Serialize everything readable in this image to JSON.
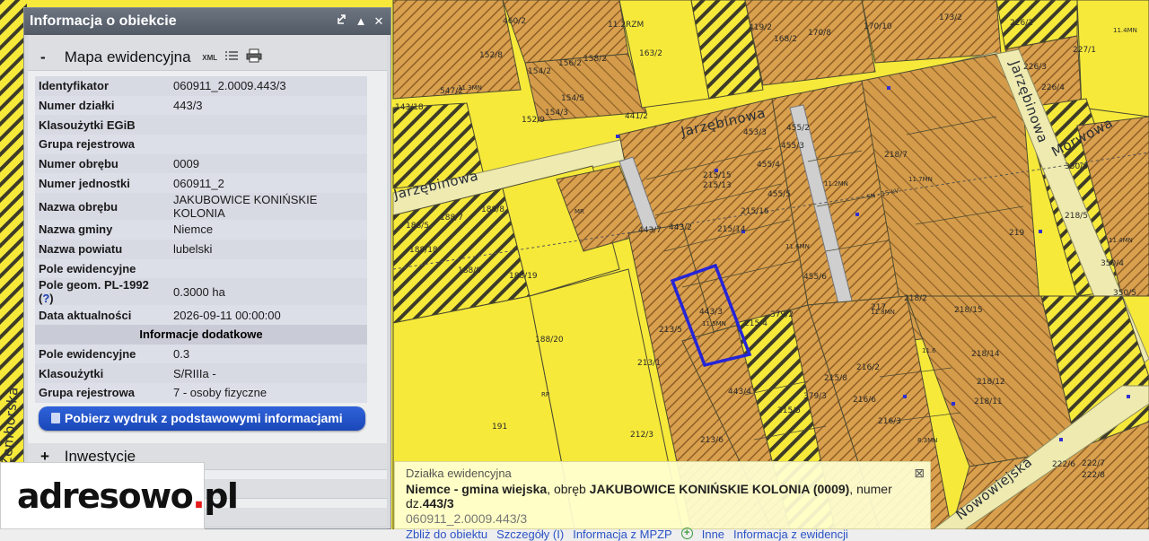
{
  "panel": {
    "title": "Informacja o obiekcie",
    "icons": [
      "link-icon",
      "collapse-up-icon",
      "close-icon"
    ],
    "section_mapa": {
      "sign": "-",
      "label": "Mapa ewidencyjna",
      "xml_label": "XML"
    },
    "attributes": [
      {
        "key": "Identyfikator",
        "value": "060911_2.0009.443/3"
      },
      {
        "key": "Numer działki",
        "value": "443/3"
      },
      {
        "key": "Klasoużytki EGiB",
        "value": ""
      },
      {
        "key": "Grupa rejestrowa",
        "value": ""
      },
      {
        "key": "Numer obrębu",
        "value": "0009"
      },
      {
        "key": "Numer jednostki",
        "value": "060911_2"
      },
      {
        "key": "Nazwa obrębu",
        "value": "JAKUBOWICE KONIŃSKIE KOLONIA"
      },
      {
        "key": "Nazwa gminy",
        "value": "Niemce"
      },
      {
        "key": "Nazwa powiatu",
        "value": "lubelski"
      },
      {
        "key": "Pole ewidencyjne",
        "value": ""
      },
      {
        "key": "Pole geom. PL-1992",
        "help": "?",
        "value": "0.3000 ha"
      },
      {
        "key": "Data aktualności",
        "value": "2026-09-11 00:00:00"
      }
    ],
    "subheader": "Informacje dodatkowe",
    "extra_attributes": [
      {
        "key": "Pole ewidencyjne",
        "value": "0.3"
      },
      {
        "key": "Klasoużytki",
        "value": "S/RIIIa -"
      },
      {
        "key": "Grupa rejestrowa",
        "value": "7 - osoby fizyczne"
      }
    ],
    "download_button": "Pobierz wydruk z podstawowymi informacjami",
    "section_inwestycje": {
      "sign": "+",
      "label": "Inwestycje"
    }
  },
  "logo": {
    "text_a": "adresowo",
    "dot": ".",
    "text_b": "pl"
  },
  "popup": {
    "title": "Działka ewidencyjna",
    "gmina": "Niemce - gmina wiejska",
    "sep1": ", obręb ",
    "obreb": "JAKUBOWICE KONIŃSKIE KOLONIA (0009)",
    "sep2": ", numer dz.",
    "numer": "443/3",
    "identifier": "060911_2.0009.443/3",
    "links": [
      "Zbliż do obiektu",
      "Szczegóły (I)",
      "Informacja z MPZP",
      "Inne",
      "Informacja z ewidencji"
    ]
  },
  "map": {
    "roads": [
      "Jarzębinowa",
      "Jarzębinowa",
      "Morwowa",
      "Jarzębinowa",
      "Nowowiejska",
      "Zemborska"
    ],
    "parcel_labels": [
      "460/2",
      "11.2RZM",
      "163/2",
      "419/2",
      "168/2",
      "170/8",
      "170/10",
      "173/2",
      "226/2",
      "227/1",
      "152/8",
      "154/2",
      "156/2",
      "158/2",
      "547/2",
      "154/3",
      "154/5",
      "152/9",
      "143/18",
      "441/2",
      "453/3",
      "455/3",
      "455/2",
      "218/7",
      "455/4",
      "188/5",
      "188/7",
      "188/8",
      "188/18",
      "188/9",
      "188/19",
      "188/20",
      "443/7",
      "443/2",
      "215/15",
      "215/16",
      "215/14",
      "215/13",
      "455/5",
      "455/6",
      "217",
      "219",
      "350/4",
      "350/5",
      "218/5",
      "218/2",
      "218/15",
      "218/14",
      "218/12",
      "443/3",
      "213/5",
      "215/4",
      "379/2",
      "213/1",
      "443/4",
      "215/8",
      "216/2",
      "216/6",
      "215/5",
      "379/3",
      "212/3",
      "213/6",
      "191",
      "218/11",
      "216/3",
      "222/6",
      "222/7",
      "222/8",
      "226/3",
      "226/4",
      "350/8",
      "11.4MN",
      "11.3MN",
      "11.5MN",
      "11.6MN",
      "11.8MN",
      "11.7MN",
      "11.2MN",
      "11.4MN",
      "8.3MN",
      "11.6",
      "RP",
      "MR",
      "SN - 15 kV"
    ]
  },
  "colors": {
    "zone_yellow": "#f6e93a",
    "zone_orange": "#d9a04e",
    "parcel_line": "#4c4a30",
    "selected_outline": "#2525d8",
    "panel_header": "#5f6773"
  }
}
